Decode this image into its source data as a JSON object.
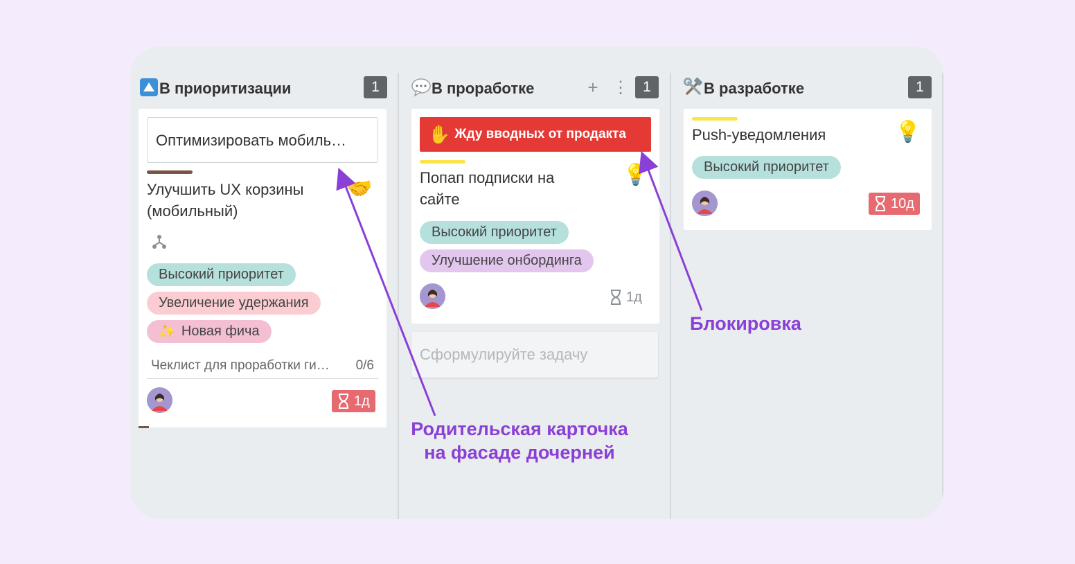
{
  "columns": [
    {
      "title": "В приоритизации",
      "count": "1",
      "icon": "up-arrow-icon"
    },
    {
      "title": "В проработке",
      "count": "1",
      "icon": "speech-bubble-icon",
      "add_label": "+",
      "more_label": "⋮"
    },
    {
      "title": "В разработке",
      "count": "1",
      "icon": "hammer-wrench-icon"
    }
  ],
  "card1": {
    "parent_title": "Оптимизировать мобиль…",
    "title_line1": "Улучшить UX корзины",
    "title_line2": "(мобильный)",
    "stripe_color": "#795548",
    "emoji": "🤝",
    "tags": [
      "Высокий приоритет",
      "Увеличение удержания",
      "Новая фича"
    ],
    "sparkle": "✨",
    "checklist_name": "Чеклист для проработки ги…",
    "checklist_progress": "0/6",
    "timer": "1д"
  },
  "card2": {
    "block_emoji": "✋",
    "block_text": "Жду вводных от продакта",
    "title_line1": "Попап подписки на",
    "title_line2": "сайте",
    "stripe_color": "#fbe44a",
    "bulb": "💡",
    "tags": [
      "Высокий приоритет",
      "Улучшение онбординга"
    ],
    "timer": "1д"
  },
  "new_task": {
    "placeholder": "Сформулируйте задачу"
  },
  "card3": {
    "title": "Push-уведомления",
    "stripe_color": "#fbe44a",
    "bulb": "💡",
    "tags": [
      "Высокий приоритет"
    ],
    "timer": "10д"
  },
  "annotations": {
    "parent_line1": "Родительская карточка",
    "parent_line2": "на фасаде дочерней",
    "block": "Блокировка"
  },
  "colors": {
    "annotation": "#8a3fd6",
    "blocked": "#e53935",
    "timer_overdue": "#e66a6f"
  }
}
